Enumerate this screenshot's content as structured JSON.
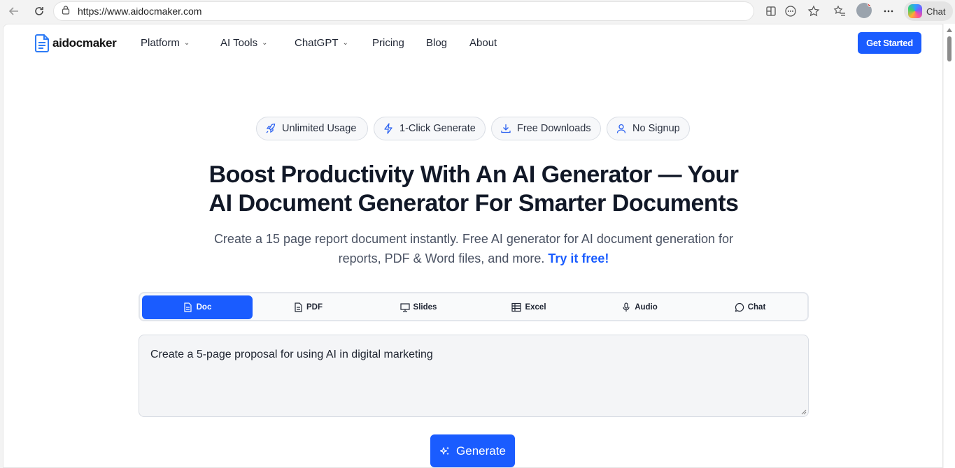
{
  "browser": {
    "url": "https://www.aidocmaker.com",
    "chat_label": "Chat"
  },
  "site": {
    "logo_text": "aidocmaker",
    "nav": [
      {
        "label": "Platform",
        "has_dropdown": true
      },
      {
        "label": "AI Tools",
        "has_dropdown": true
      },
      {
        "label": "ChatGPT",
        "has_dropdown": true
      },
      {
        "label": "Pricing",
        "has_dropdown": false
      },
      {
        "label": "Blog",
        "has_dropdown": false
      },
      {
        "label": "About",
        "has_dropdown": false
      }
    ],
    "cta_label": "Get Started",
    "accent_color": "#1a5cff"
  },
  "features": [
    {
      "label": "Unlimited Usage",
      "icon": "rocket-icon"
    },
    {
      "label": "1-Click Generate",
      "icon": "lightning-icon"
    },
    {
      "label": "Free Downloads",
      "icon": "download-icon"
    },
    {
      "label": "No Signup",
      "icon": "user-icon"
    }
  ],
  "hero": {
    "headline_line1": "Boost Productivity With An AI Generator — Your",
    "headline_line2": "AI Document Generator For Smarter Documents",
    "sub_line1": "Create a 15 page report document instantly. Free AI generator for AI document generation for",
    "sub_line2": "reports, PDF & Word files, and more.",
    "sub_link": "Try it free!"
  },
  "tabs": [
    {
      "label": "Doc",
      "icon": "document-icon",
      "active": true
    },
    {
      "label": "PDF",
      "icon": "pdf-icon",
      "active": false
    },
    {
      "label": "Slides",
      "icon": "presentation-icon",
      "active": false
    },
    {
      "label": "Excel",
      "icon": "table-icon",
      "active": false
    },
    {
      "label": "Audio",
      "icon": "microphone-icon",
      "active": false
    },
    {
      "label": "Chat",
      "icon": "chat-bubble-icon",
      "active": false
    }
  ],
  "prompt": {
    "value": "Create a 5-page proposal for using AI in digital marketing"
  },
  "generate_label": "Generate"
}
